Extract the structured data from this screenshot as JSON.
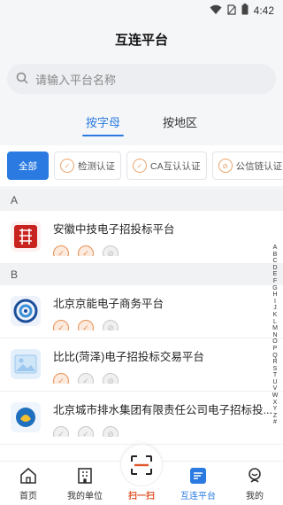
{
  "status": {
    "time": "4:42"
  },
  "header": {
    "title": "互连平台"
  },
  "search": {
    "placeholder": "请输入平台名称"
  },
  "tabs": [
    {
      "label": "按字母",
      "active": true
    },
    {
      "label": "按地区",
      "active": false
    }
  ],
  "filters": [
    {
      "label": "全部",
      "active": true
    },
    {
      "label": "检测认证",
      "active": false
    },
    {
      "label": "CA互认认证",
      "active": false
    },
    {
      "label": "公信链认证",
      "active": false
    }
  ],
  "groups": [
    {
      "letter": "A",
      "items": [
        {
          "name": "安徽中技电子招投标平台",
          "logo": "seal-logo",
          "badges": [
            "on",
            "on",
            "off"
          ]
        }
      ]
    },
    {
      "letter": "B",
      "items": [
        {
          "name": "北京京能电子商务平台",
          "logo": "swirl-logo",
          "badges": [
            "on",
            "on",
            "off"
          ]
        },
        {
          "name": "比比(菏泽)电子招投标交易平台",
          "logo": "image-placeholder",
          "badges": [
            "on",
            "off",
            "off"
          ]
        },
        {
          "name": "北京城市排水集团有限责任公司电子招标投...",
          "logo": "drop-logo",
          "badges": [
            "off",
            "off",
            "off"
          ]
        }
      ]
    }
  ],
  "index_letters": [
    "A",
    "B",
    "C",
    "D",
    "E",
    "F",
    "G",
    "H",
    "I",
    "J",
    "K",
    "L",
    "M",
    "N",
    "O",
    "P",
    "Q",
    "R",
    "S",
    "T",
    "U",
    "V",
    "W",
    "X",
    "Y",
    "Z",
    "#"
  ],
  "bottom_nav": [
    {
      "label": "首页",
      "icon": "home-icon"
    },
    {
      "label": "我的单位",
      "icon": "building-icon"
    },
    {
      "label": "扫一扫",
      "icon": "scan-icon"
    },
    {
      "label": "互连平台",
      "icon": "platform-icon",
      "active": true
    },
    {
      "label": "我的",
      "icon": "profile-icon"
    }
  ],
  "colors": {
    "accent": "#2a7ae2",
    "badge_on": "#e98f54",
    "scan": "#e0562b"
  }
}
